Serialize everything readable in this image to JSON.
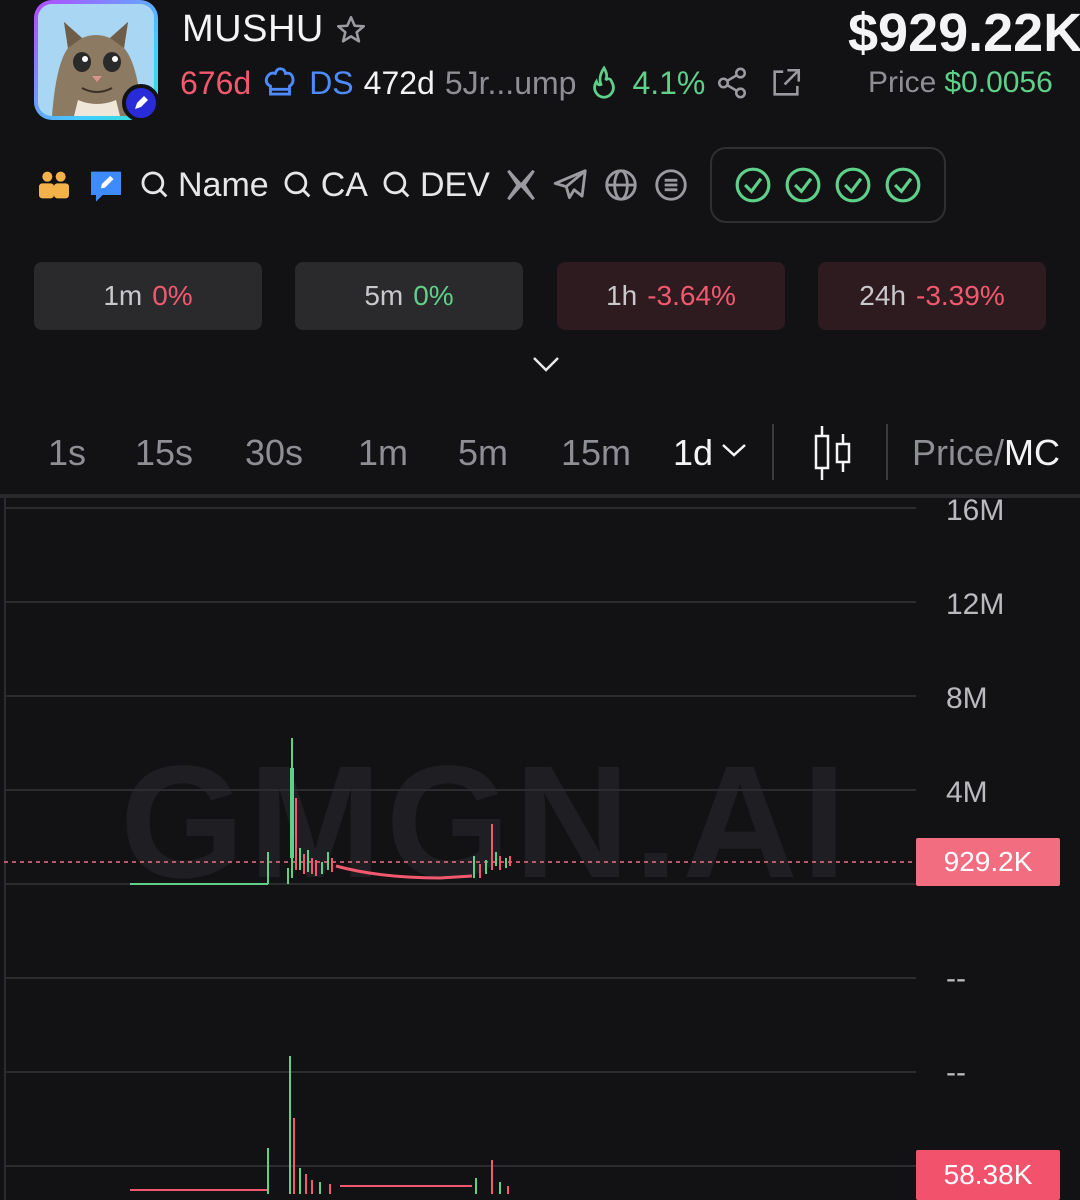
{
  "token": {
    "name": "MUSHU",
    "market_cap": "$929.22K",
    "age": "676d",
    "ds_label": "DS",
    "ds_age": "472d",
    "address_short": "5Jr...ump",
    "burn_pct": "4.1%",
    "price_label": "Price",
    "price_value": "$0.0056"
  },
  "links": {
    "name": "Name",
    "ca": "CA",
    "dev": "DEV"
  },
  "changes": [
    {
      "label": "1m",
      "value": "0%",
      "dir": "pos"
    },
    {
      "label": "5m",
      "value": "0%",
      "dir": "pos"
    },
    {
      "label": "1h",
      "value": "-3.64%",
      "dir": "neg"
    },
    {
      "label": "24h",
      "value": "-3.39%",
      "dir": "neg"
    }
  ],
  "timeframes": {
    "items": [
      "1s",
      "15s",
      "30s",
      "1m",
      "5m",
      "15m"
    ],
    "active": "1d",
    "price_label": "Price/",
    "mc_label": "MC"
  },
  "chart": {
    "watermark": "GMGN.AI",
    "y_axis": [
      "16M",
      "12M",
      "8M",
      "4M"
    ],
    "vol_axis": [
      "--",
      "--"
    ],
    "last_price_tag": "929.2K",
    "volume_tag": "58.38K",
    "colors": {
      "up": "#5fd08a",
      "down": "#f2596e",
      "tag": "#f26d80"
    }
  }
}
